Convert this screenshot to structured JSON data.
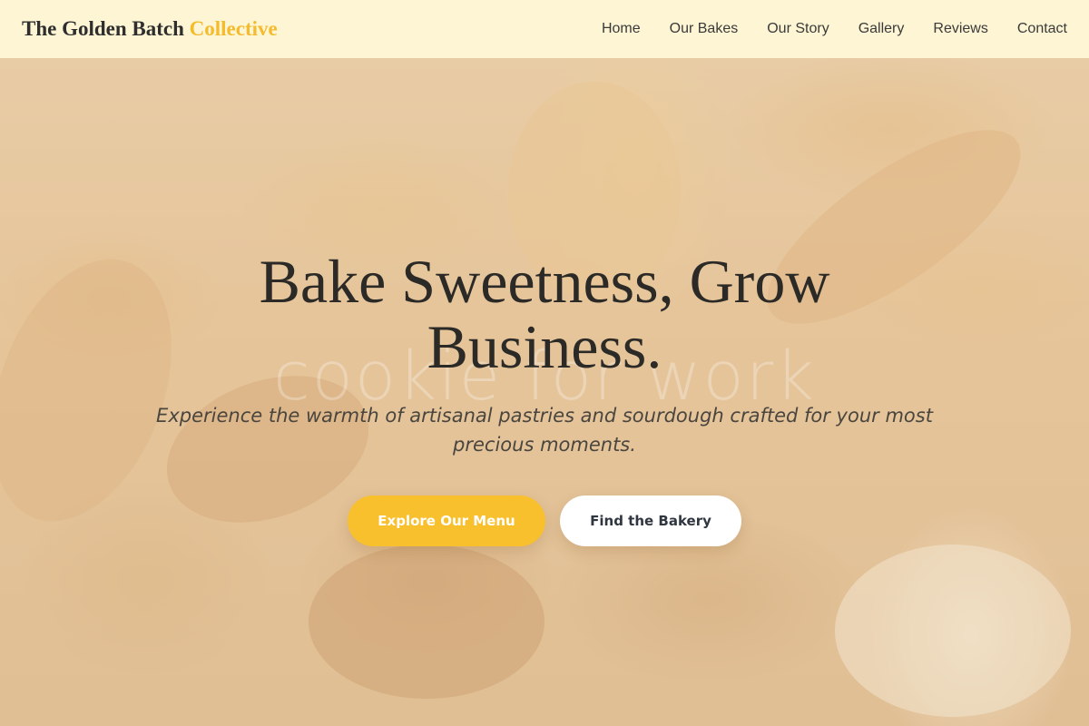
{
  "header": {
    "brand_main": "The Golden Batch ",
    "brand_accent": "Collective",
    "nav": [
      "Home",
      "Our Bakes",
      "Our Story",
      "Gallery",
      "Reviews",
      "Contact"
    ]
  },
  "hero": {
    "title": "Bake Sweetness, Grow Business.",
    "subtitle": "Experience the warmth of artisanal pastries and sourdough crafted for your most precious moments.",
    "primary_cta": "Explore Our Menu",
    "secondary_cta": "Find the Bakery",
    "watermark": "cookie for work"
  },
  "colors": {
    "accent": "#f9c02d",
    "header_bg": "#fef8d6",
    "text_dark": "#2b2a27"
  }
}
